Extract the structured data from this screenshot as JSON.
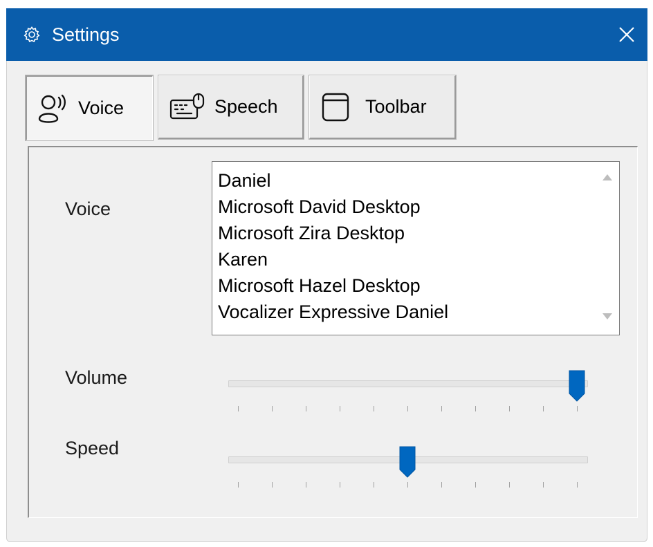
{
  "window": {
    "title": "Settings",
    "title_icon": "gear-icon",
    "close_icon": "close-icon",
    "accent_color": "#0a5dab"
  },
  "tabs": [
    {
      "label": "Voice",
      "icon": "voice-icon",
      "active": true
    },
    {
      "label": "Speech",
      "icon": "keyboard-mouse-icon",
      "active": false
    },
    {
      "label": "Toolbar",
      "icon": "window-icon",
      "active": false
    }
  ],
  "voice_panel": {
    "voice_label": "Voice",
    "voices": [
      "Daniel",
      "Microsoft David Desktop",
      "Microsoft Zira Desktop",
      "Karen",
      "Microsoft Hazel Desktop",
      "Vocalizer Expressive Daniel"
    ],
    "volume_label": "Volume",
    "volume_value": 1.0,
    "speed_label": "Speed",
    "speed_value": 0.5,
    "tick_count": 11,
    "thumb_color": "#0067c0"
  }
}
